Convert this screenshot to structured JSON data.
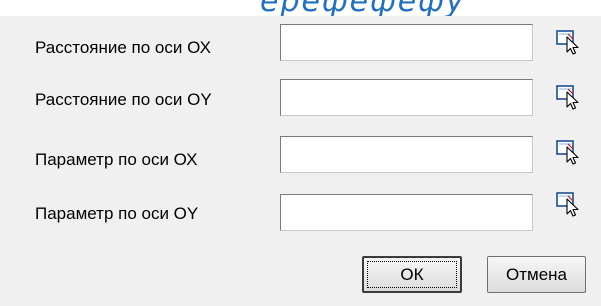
{
  "fields": [
    {
      "label": "Расстояние по оси ОХ",
      "value": ""
    },
    {
      "label": "Расстояние по оси ОY",
      "value": ""
    },
    {
      "label": "Параметр по оси ОХ",
      "value": ""
    },
    {
      "label": "Параметр по оси ОY",
      "value": ""
    }
  ],
  "buttons": {
    "ok_label": "ОК",
    "cancel_label": "Отмена"
  },
  "icons": {
    "pick": "pick-from-drawing-icon"
  },
  "colors": {
    "dialog_bg": "#f0f0f0",
    "field_bg": "#ffffff",
    "top_text": "#1f6fc2"
  }
}
